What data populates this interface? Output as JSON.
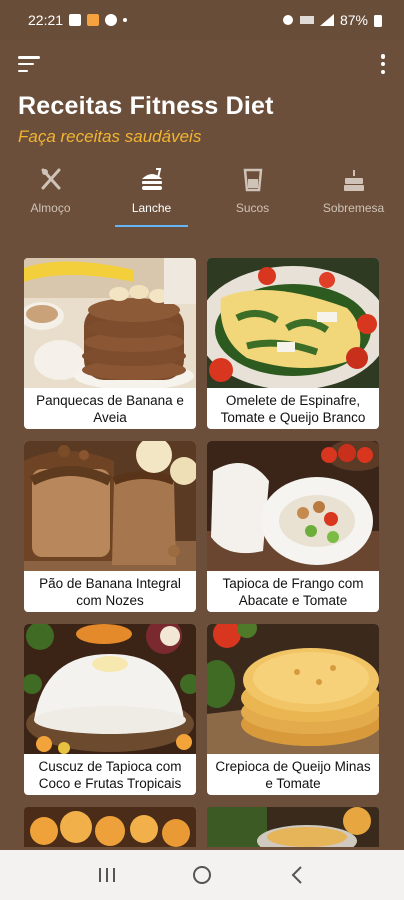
{
  "status_bar": {
    "time": "22:21",
    "battery": "87%"
  },
  "app": {
    "title": "Receitas Fitness Diet",
    "subtitle": "Faça receitas saudáveis",
    "accent_color": "#f2b531",
    "background_color": "#6b4f3a",
    "tab_indicator_color": "#64b5f6"
  },
  "tabs": [
    {
      "label": "Almoço",
      "icon": "fork-knife-icon",
      "active": false
    },
    {
      "label": "Lanche",
      "icon": "burger-icon",
      "active": true
    },
    {
      "label": "Sucos",
      "icon": "cup-icon",
      "active": false
    },
    {
      "label": "Sobremesa",
      "icon": "cake-icon",
      "active": false
    }
  ],
  "recipes": [
    {
      "title": "Panquecas de Banana e Aveia"
    },
    {
      "title": "Omelete de Espinafre, Tomate e Queijo Branco"
    },
    {
      "title": "Pão de Banana Integral com Nozes"
    },
    {
      "title": "Tapioca de Frango com Abacate e Tomate"
    },
    {
      "title": "Cuscuz de Tapioca com Coco e Frutas Tropicais"
    },
    {
      "title": "Crepioca de Queijo Minas e Tomate"
    }
  ]
}
